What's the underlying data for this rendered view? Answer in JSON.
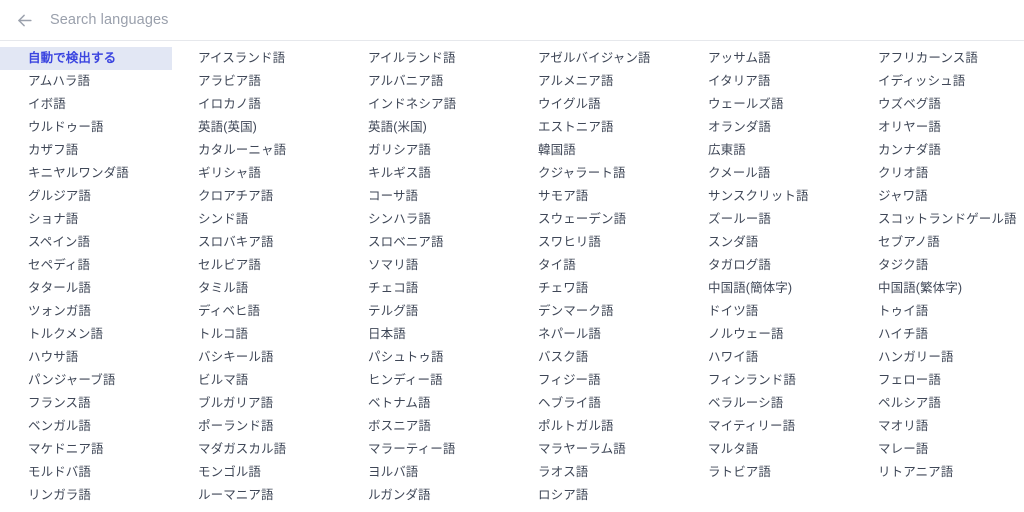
{
  "search": {
    "placeholder": "Search languages",
    "value": "",
    "back_icon": "arrow-left-icon"
  },
  "theme": {
    "selected_bg": "#e2e7f4",
    "selected_text": "#3b45e0",
    "item_text": "#3f4757",
    "placeholder_text": "#9aa0ac",
    "background": "#ffffff"
  },
  "languages": {
    "columns": 6,
    "flow": "row-major",
    "selected_index": 0,
    "count": 118,
    "items": [
      "自動で検出する",
      "アイスランド語",
      "アイルランド語",
      "アゼルバイジャン語",
      "アッサム語",
      "アフリカーンス語",
      "アムハラ語",
      "アラビア語",
      "アルバニア語",
      "アルメニア語",
      "イタリア語",
      "イディッシュ語",
      "イボ語",
      "イロカノ語",
      "インドネシア語",
      "ウイグル語",
      "ウェールズ語",
      "ウズベグ語",
      "ウルドゥー語",
      "英語(英国)",
      "英語(米国)",
      "エストニア語",
      "オランダ語",
      "オリヤー語",
      "カザフ語",
      "カタルーニャ語",
      "ガリシア語",
      "韓国語",
      "広東語",
      "カンナダ語",
      "キニヤルワンダ語",
      "ギリシャ語",
      "キルギス語",
      "クジャラート語",
      "クメール語",
      "クリオ語",
      "グルジア語",
      "クロアチア語",
      "コーサ語",
      "サモア語",
      "サンスクリット語",
      "ジャワ語",
      "ショナ語",
      "シンド語",
      "シンハラ語",
      "スウェーデン語",
      "ズールー語",
      "スコットランドゲール語",
      "スペイン語",
      "スロバキア語",
      "スロベニア語",
      "スワヒリ語",
      "スンダ語",
      "セブアノ語",
      "セペディ語",
      "セルビア語",
      "ソマリ語",
      "タイ語",
      "タガログ語",
      "タジク語",
      "タタール語",
      "タミル語",
      "チェコ語",
      "チェワ語",
      "中国語(簡体字)",
      "中国語(繁体字)",
      "ツォンガ語",
      "ディベヒ語",
      "テルグ語",
      "デンマーク語",
      "ドイツ語",
      "トゥイ語",
      "トルクメン語",
      "トルコ語",
      "日本語",
      "ネパール語",
      "ノルウェー語",
      "ハイチ語",
      "ハウサ語",
      "バシキール語",
      "パシュトゥ語",
      "バスク語",
      "ハワイ語",
      "ハンガリー語",
      "パンジャーブ語",
      "ビルマ語",
      "ヒンディー語",
      "フィジー語",
      "フィンランド語",
      "フェロー語",
      "フランス語",
      "ブルガリア語",
      "ベトナム語",
      "ヘブライ語",
      "ベラルーシ語",
      "ペルシア語",
      "ベンガル語",
      "ポーランド語",
      "ボスニア語",
      "ポルトガル語",
      "マイティリー語",
      "マオリ語",
      "マケドニア語",
      "マダガスカル語",
      "マラーティー語",
      "マラヤーラム語",
      "マルタ語",
      "マレー語",
      "モルドバ語",
      "モンゴル語",
      "ヨルバ語",
      "ラオス語",
      "ラトビア語",
      "リトアニア語",
      "リンガラ語",
      "ルーマニア語",
      "ルガンダ語",
      "ロシア語"
    ]
  }
}
